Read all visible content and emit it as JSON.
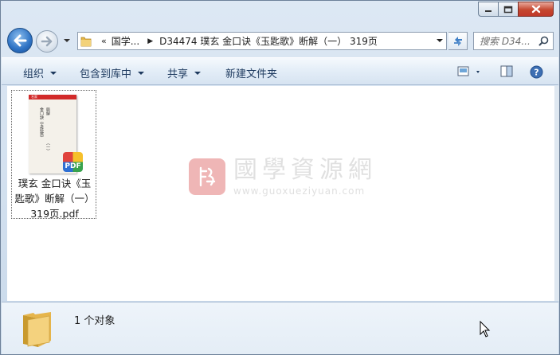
{
  "window": {
    "caption_buttons": [
      "minimize",
      "maximize",
      "close"
    ]
  },
  "address_bar": {
    "overflow_label": "«",
    "crumbs": [
      "国学...",
      "D34474 璞玄 金口诀《玉匙歌》断解（一） 319页"
    ]
  },
  "search": {
    "placeholder": "搜索 D34..."
  },
  "toolbar": {
    "organize": "组织",
    "include_in_library": "包含到库中",
    "share": "共享",
    "new_folder": "新建文件夹"
  },
  "files": [
    {
      "name": "璞玄 金口诀《玉匙歌》断解（一）319页.pdf",
      "name_lines": [
        "璞玄 金口诀《玉",
        "匙歌》断解（一）",
        "319页.pdf"
      ],
      "badge": "PDF",
      "thumb_band": "名家",
      "thumb_columns": [
        "金口訣《玉匙歌》",
        "斷解",
        "（一）"
      ]
    }
  ],
  "watermark": {
    "title": "國學資源網",
    "url": "www.guoxueziyuan.com"
  },
  "status": {
    "count_text": "1 个对象"
  },
  "colors": {
    "pdf_badge": [
      "#f6c02b",
      "#38a34d",
      "#2f6fd4",
      "#e0433d"
    ],
    "close_button": "#c5472f",
    "toolbar_text": "#1e3a5f"
  }
}
